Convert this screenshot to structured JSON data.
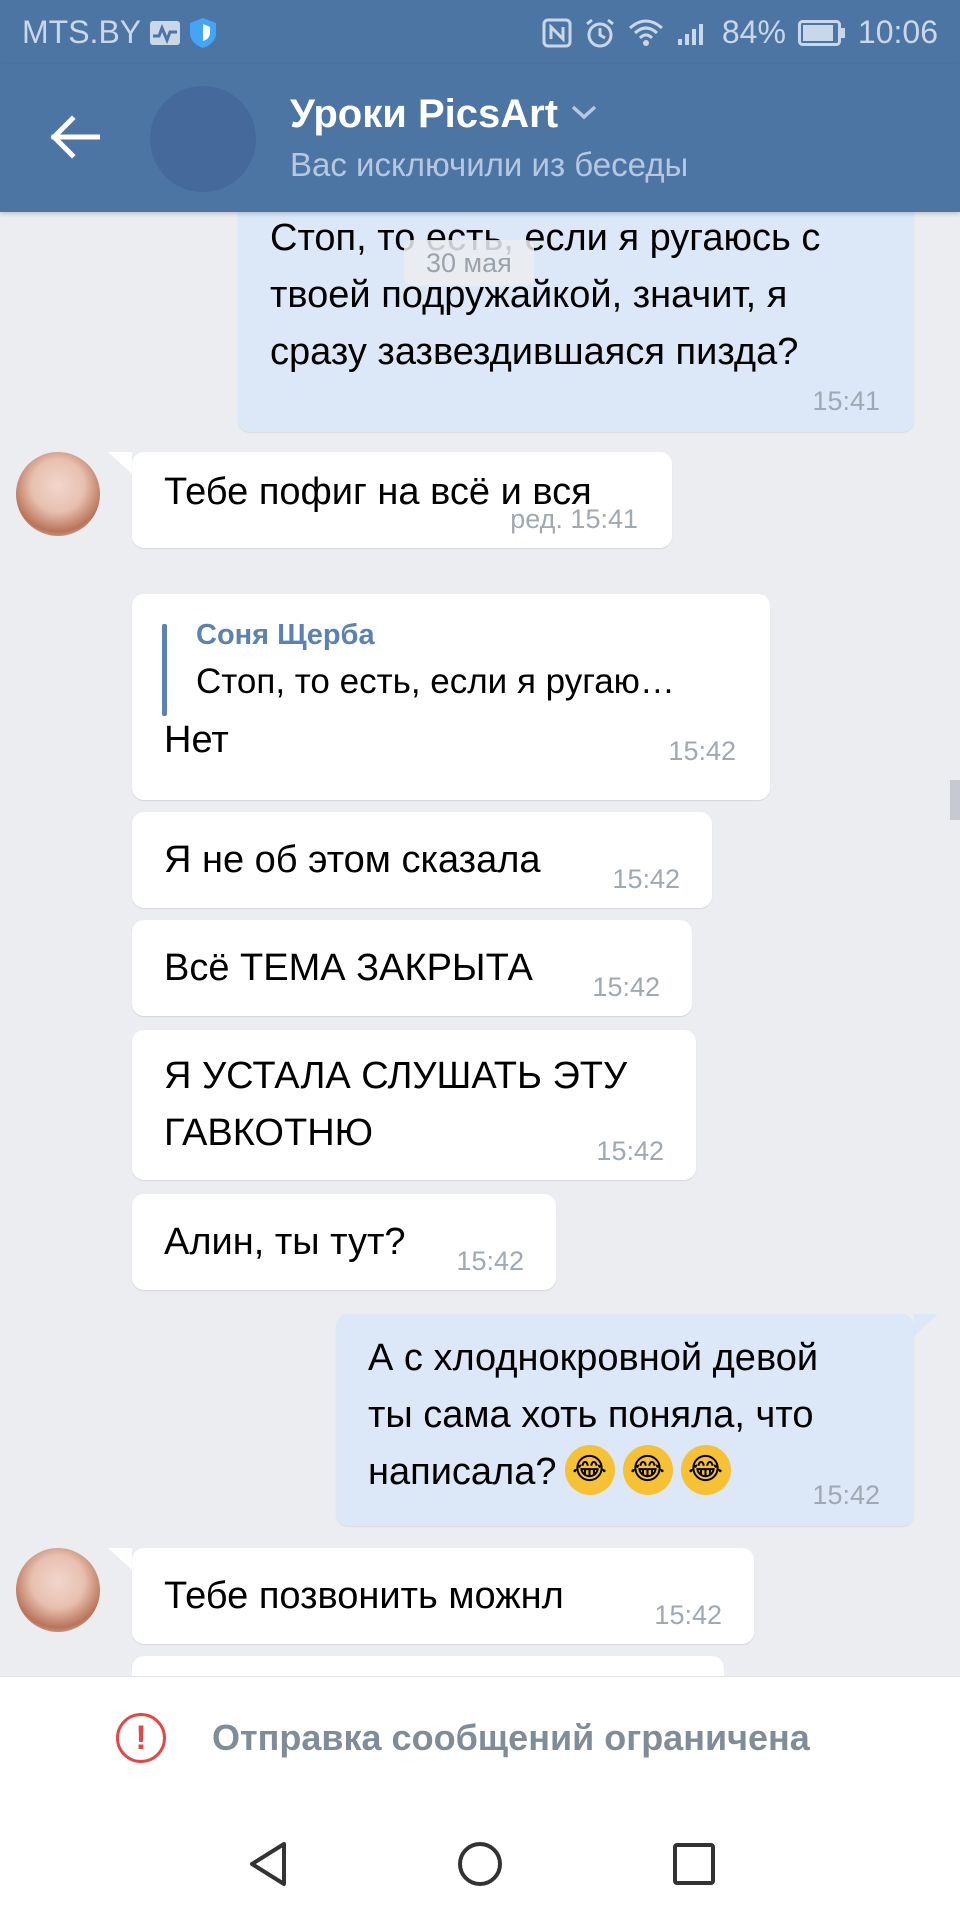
{
  "status_bar": {
    "carrier": "MTS.BY",
    "battery": "84%",
    "time": "10:06"
  },
  "header": {
    "title": "Уроки PicsArt",
    "subtitle": "Вас исключили из беседы"
  },
  "date_label": "30 мая",
  "messages": [
    {
      "dir": "out",
      "lines": [
        "Стоп, то есть, если я ругаюсь с",
        "твоей подружайкой, значит, я",
        "сразу зазвездившаяся пизда?"
      ],
      "time": "15:41"
    },
    {
      "dir": "in",
      "lines": [
        "Тебе пофиг на всё и вся"
      ],
      "time": "ред. 15:41"
    },
    {
      "dir": "in",
      "reply_author": "Соня Щерба",
      "reply_text": "Стоп, то есть, если я ругаю…",
      "lines": [
        "Нет"
      ],
      "time": "15:42"
    },
    {
      "dir": "in",
      "lines": [
        "Я не об этом сказала"
      ],
      "time": "15:42"
    },
    {
      "dir": "in",
      "lines": [
        "Всё ТЕМА ЗАКРЫТА"
      ],
      "time": "15:42"
    },
    {
      "dir": "in",
      "lines": [
        "Я УСТАЛА СЛУШАТЬ ЭТУ",
        "ГАВКОТНЮ"
      ],
      "time": "15:42"
    },
    {
      "dir": "in",
      "lines": [
        "Алин, ты тут?"
      ],
      "time": "15:42"
    },
    {
      "dir": "out",
      "lines": [
        "А с хлоднокровной девой",
        "ты сама хоть поняла, что",
        "написала?"
      ],
      "emoji": [
        "😂",
        "😂",
        "😂"
      ],
      "time": "15:42"
    },
    {
      "dir": "in",
      "lines": [
        "Тебе позвонить можнл"
      ],
      "time": "15:42"
    }
  ],
  "restricted_banner": {
    "icon": "exclamation-circle-icon",
    "text": "Отправка сообщений ограничена"
  },
  "colors": {
    "header": "#4c75a3",
    "incoming_bubble": "#ffffff",
    "outgoing_bubble": "#dce8f7",
    "background": "#ebedf0",
    "accent": "#5b82b3",
    "warning": "#e64646"
  }
}
